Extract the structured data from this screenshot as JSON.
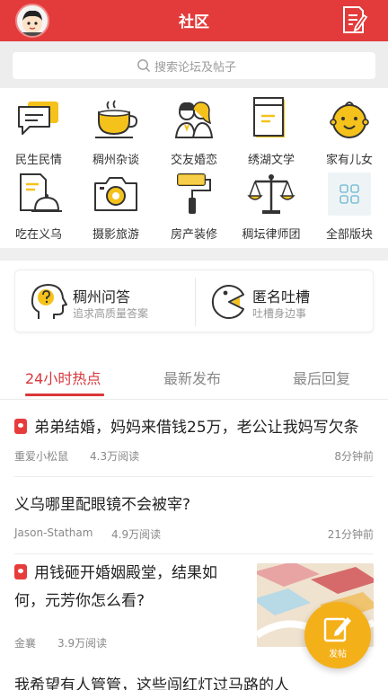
{
  "header": {
    "title": "社区"
  },
  "search": {
    "placeholder": "搜索论坛及帖子"
  },
  "categories": [
    {
      "label": "民生民情",
      "icon": "speech-bubble-icon"
    },
    {
      "label": "稠州杂谈",
      "icon": "tea-cup-icon"
    },
    {
      "label": "交友婚恋",
      "icon": "couple-icon"
    },
    {
      "label": "绣湖文学",
      "icon": "book-icon"
    },
    {
      "label": "家有儿女",
      "icon": "baby-face-icon"
    },
    {
      "label": "吃在义乌",
      "icon": "food-cloche-icon"
    },
    {
      "label": "摄影旅游",
      "icon": "camera-icon"
    },
    {
      "label": "房产装修",
      "icon": "paint-roller-icon"
    },
    {
      "label": "稠坛律师团",
      "icon": "scales-icon"
    },
    {
      "label": "全部版块",
      "icon": "grid-icon"
    }
  ],
  "qa": [
    {
      "title": "稠州问答",
      "subtitle": "追求高质量答案",
      "icon": "question-head-icon"
    },
    {
      "title": "匿名吐槽",
      "subtitle": "吐槽身边事",
      "icon": "pacman-icon"
    }
  ],
  "tabs": [
    {
      "label": "24小时热点",
      "active": true
    },
    {
      "label": "最新发布",
      "active": false
    },
    {
      "label": "最后回复",
      "active": false
    }
  ],
  "posts": [
    {
      "title": "弟弟结婚，妈妈来借钱25万，老公让我妈写欠条",
      "author": "重爱小松鼠",
      "reads": "4.3万阅读",
      "time": "8分钟前",
      "hot": true
    },
    {
      "title": "义乌哪里配眼镜不会被宰?",
      "author": "Jason-Statham",
      "reads": "4.9万阅读",
      "time": "21分钟前",
      "hot": false
    },
    {
      "title_line1": "用钱砸开婚姻殿堂，结果如",
      "title_line2": "何，元芳你怎么看?",
      "author": "金襄",
      "reads": "3.9万阅读",
      "hot": true
    },
    {
      "title": "我希望有人管管，这些闯红灯过马路的人"
    }
  ],
  "fab": {
    "label": "发帖"
  },
  "colors": {
    "brand_red": "#e33b3b",
    "tab_active": "#d9373b",
    "icon_yellow": "#f5c21b",
    "fab": "#f4b019"
  }
}
